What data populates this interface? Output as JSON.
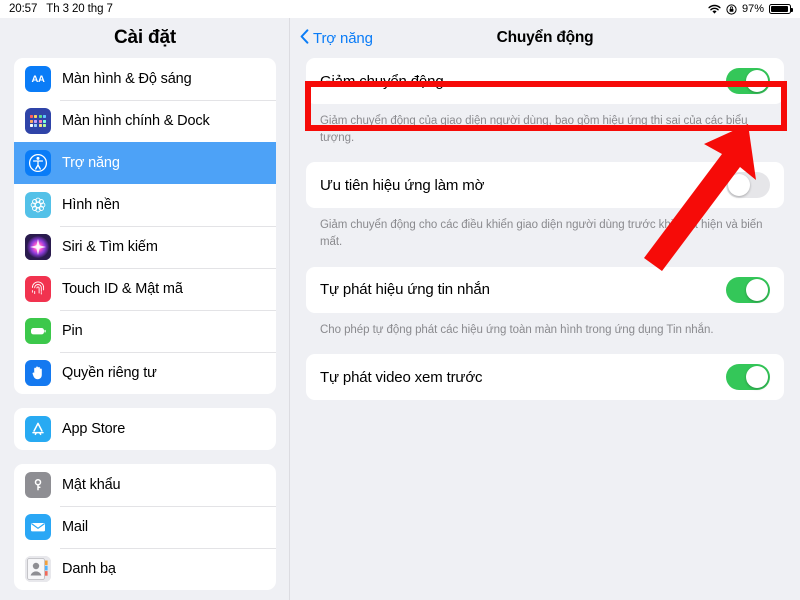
{
  "status_bar": {
    "time": "20:57",
    "date": "Th 3 20 thg 7",
    "wifi_icon": "wifi-icon",
    "rotation_lock_icon": "rotation-lock-icon",
    "battery_percent": "97%",
    "battery_icon": "battery-icon"
  },
  "sidebar": {
    "title": "Cài đặt",
    "groups": [
      {
        "items": [
          {
            "label": "Màn hình & Độ sáng",
            "icon": "display-brightness-icon",
            "icon_bg": "#0a7cf7",
            "icon_glyph": "AA",
            "selected": false
          },
          {
            "label": "Màn hình chính & Dock",
            "icon": "home-screen-dock-icon",
            "icon_bg": "#2f44a8",
            "selected": false
          },
          {
            "label": "Trợ năng",
            "icon": "accessibility-icon",
            "icon_bg": "#0a7cf7",
            "selected": true
          },
          {
            "label": "Hình nền",
            "icon": "wallpaper-icon",
            "icon_bg": "#53c1e8",
            "selected": false
          },
          {
            "label": "Siri & Tìm kiếm",
            "icon": "siri-icon",
            "icon_bg": "#2a1b4e",
            "selected": false
          },
          {
            "label": "Touch ID & Mật mã",
            "icon": "touch-id-icon",
            "icon_bg": "#f1334f",
            "selected": false
          },
          {
            "label": "Pin",
            "icon": "battery-settings-icon",
            "icon_bg": "#3cc84b",
            "selected": false
          },
          {
            "label": "Quyền riêng tư",
            "icon": "privacy-hand-icon",
            "icon_bg": "#1479f0",
            "selected": false
          }
        ]
      },
      {
        "items": [
          {
            "label": "App Store",
            "icon": "app-store-icon",
            "icon_bg": "#28aaf2",
            "selected": false
          }
        ]
      },
      {
        "items": [
          {
            "label": "Mật khẩu",
            "icon": "passwords-key-icon",
            "icon_bg": "#8e8e93",
            "selected": false
          },
          {
            "label": "Mail",
            "icon": "mail-icon",
            "icon_bg": "#2aa7f5",
            "selected": false
          },
          {
            "label": "Danh bạ",
            "icon": "contacts-icon",
            "icon_bg": "#d8d8dc",
            "selected": false
          }
        ]
      }
    ]
  },
  "content": {
    "back_label": "Trợ năng",
    "back_icon": "chevron-left-icon",
    "title": "Chuyển động",
    "sections": [
      {
        "row_label": "Giảm chuyển động",
        "toggle_state": "on",
        "note": "Giảm chuyển động của giao diện người dùng, bao gồm hiệu ứng thị sai của các biểu tượng."
      },
      {
        "row_label": "Ưu tiên hiệu ứng làm mờ",
        "toggle_state": "off",
        "note": "Giảm chuyển động cho các điều khiển giao diện người dùng trước khi xuất hiện và biến mất."
      },
      {
        "row_label": "Tự phát hiệu ứng tin nhắn",
        "toggle_state": "on",
        "note": "Cho phép tự động phát các hiệu ứng toàn màn hình trong ứng dụng Tin nhắn."
      },
      {
        "row_label": "Tự phát video xem trước",
        "toggle_state": "on",
        "note": ""
      }
    ]
  },
  "annotations": {
    "highlight_color": "#f60b08",
    "arrow_color": "#f60b08",
    "highlight_target": "Giảm chuyển động",
    "arrow_target": "Giảm chuyển động toggle"
  },
  "colors": {
    "accent_blue": "#0a7cf7",
    "selected_blue": "#4da2f7",
    "toggle_on_green": "#34c759",
    "toggle_off_gray": "#e6e6e9",
    "background": "#eff0f4",
    "card_white": "#ffffff",
    "note_gray": "#8a8a8e"
  }
}
